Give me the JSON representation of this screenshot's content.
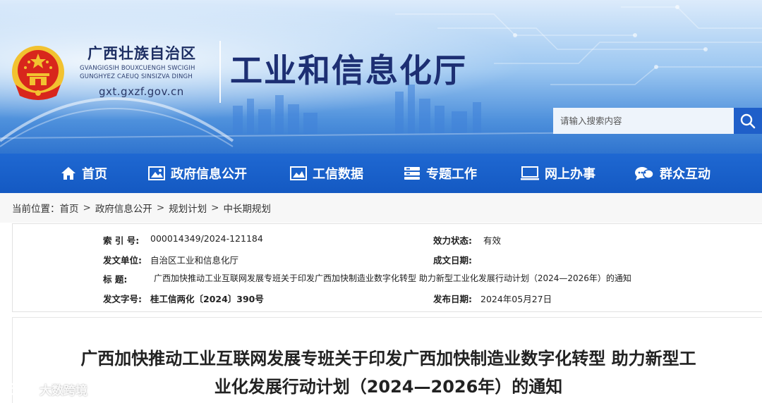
{
  "header": {
    "region_name": "广西壮族自治区",
    "region_pinyin_1": "GVANGIGSIH BOUXCUENGH SWCIGIH",
    "region_pinyin_2": "GUNGHYEZ CAEUQ SINSIZVA DINGH",
    "domain": "gxt.gxzf.gov.cn",
    "department": "工业和信息化厅",
    "emblem_icon": "national-emblem-icon"
  },
  "search": {
    "placeholder": "请输入搜索内容",
    "button_icon": "search-icon"
  },
  "nav": {
    "items": [
      {
        "label": "首页",
        "icon": "home-icon"
      },
      {
        "label": "政府信息公开",
        "icon": "image-icon"
      },
      {
        "label": "工信数据",
        "icon": "chart-icon"
      },
      {
        "label": "专题工作",
        "icon": "stack-icon"
      },
      {
        "label": "网上办事",
        "icon": "monitor-icon"
      },
      {
        "label": "群众互动",
        "icon": "chat-icon"
      }
    ]
  },
  "breadcrumb": {
    "prefix": "当前位置：",
    "items": [
      "首页",
      "政府信息公开",
      "规划计划",
      "中长期规划"
    ],
    "separator": ">"
  },
  "info": {
    "index_label": "索  引  号:",
    "index_value": "000014349/2024-121184",
    "status_label": "效力状态:",
    "status_value": "有效",
    "issuer_label": "发文单位:",
    "issuer_value": "自治区工业和信息化厅",
    "created_label": "成文日期:",
    "created_value": "",
    "title_label": "标       题:",
    "title_value": "广西加快推动工业互联网发展专班关于印发广西加快制造业数字化转型 助力新型工业化发展行动计划（2024—2026年）的通知",
    "docno_label": "发文字号:",
    "docno_value": "桂工信两化〔2024〕390号",
    "published_label": "发布日期:",
    "published_value": "2024年05月27日"
  },
  "article": {
    "title_line1": "广西加快推动工业互联网发展专班关于印发广西加快制造业数字化转型 助力新型工",
    "title_line2": "业化发展行动计划（2024—2026年）的通知"
  },
  "watermark": {
    "text": "大数跨境",
    "icon": "brand-logo-icon"
  },
  "colors": {
    "nav_bg": "#1a60c9",
    "title_dark": "#1d2f73",
    "emblem_red": "#d8261c",
    "emblem_gold": "#f2c230"
  }
}
